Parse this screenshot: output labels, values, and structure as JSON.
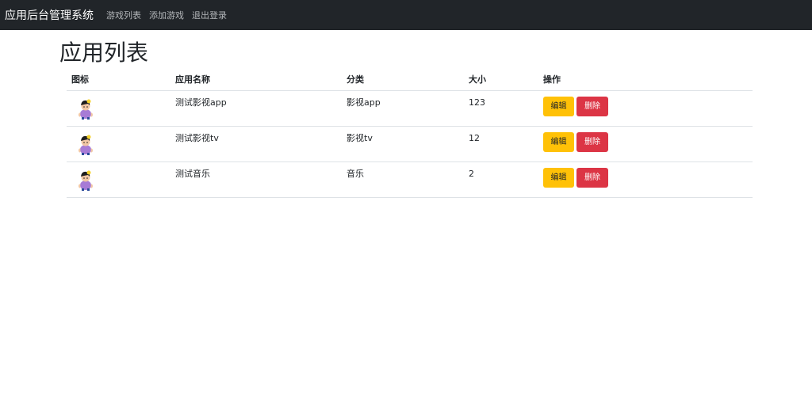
{
  "navbar": {
    "brand": "应用后台管理系统",
    "links": [
      "游戏列表",
      "添加游戏",
      "退出登录"
    ]
  },
  "page": {
    "title": "应用列表"
  },
  "table": {
    "headers": [
      "图标",
      "应用名称",
      "分类",
      "大小",
      "操作"
    ],
    "rows": [
      {
        "name": "测试影视app",
        "category": "影视app",
        "size": "123"
      },
      {
        "name": "测试影视tv",
        "category": "影视tv",
        "size": "12"
      },
      {
        "name": "测试音乐",
        "category": "音乐",
        "size": "2"
      }
    ],
    "actions": {
      "edit": "编辑",
      "delete": "删除"
    }
  },
  "colors": {
    "navbar_bg": "#212529",
    "edit_button": "#ffc107",
    "delete_button": "#dc3545"
  },
  "icons": {
    "app_icon": "cartoon-girl-icon"
  }
}
